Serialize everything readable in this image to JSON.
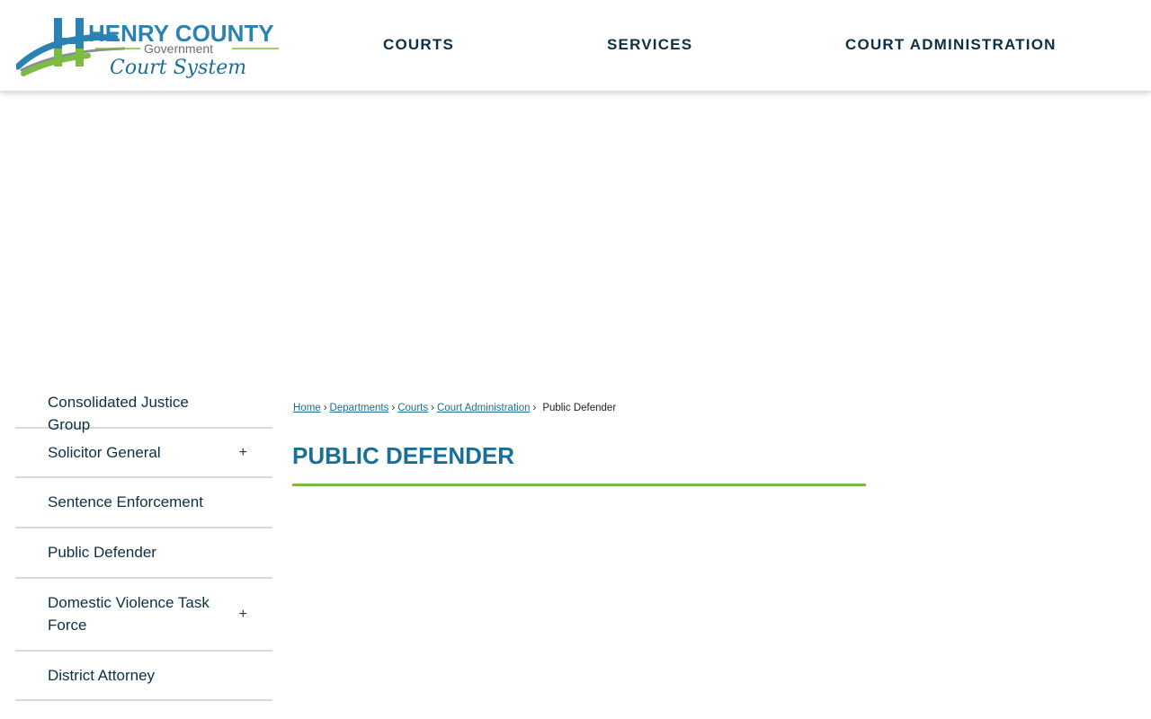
{
  "header": {
    "logo": {
      "title": "HENRY COUNTY",
      "subtitle": "Government",
      "tagline": "Court System"
    },
    "nav": [
      {
        "label": "COURTS"
      },
      {
        "label": "SERVICES"
      },
      {
        "label": "COURT ADMINISTRATION"
      }
    ]
  },
  "sidebar": {
    "items": [
      {
        "label": "Consolidated Justice Group",
        "expandable": false
      },
      {
        "label": "Solicitor General",
        "expandable": true,
        "toggle": "+"
      },
      {
        "label": "Sentence Enforcement",
        "expandable": false
      },
      {
        "label": "Public Defender",
        "expandable": false
      },
      {
        "label": "Domestic Violence Task Force",
        "expandable": true,
        "toggle": "+"
      },
      {
        "label": "District Attorney",
        "expandable": false
      }
    ]
  },
  "breadcrumb": {
    "links": [
      "Home",
      "Departments",
      "Courts",
      "Court Administration"
    ],
    "separator": "›",
    "current": "Public Defender"
  },
  "main": {
    "title": "PUBLIC DEFENDER"
  },
  "colors": {
    "brand_blue": "#1a6f9a",
    "brand_green": "#7dbb42",
    "nav_text": "#0e2f44",
    "divider": "#d9d9d9"
  }
}
